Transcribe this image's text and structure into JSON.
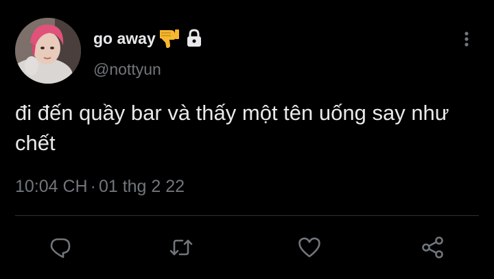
{
  "tweet": {
    "display_name": "go away",
    "handle": "@nottyun",
    "text": "đi đến quầy bar và thấy một tên uống say như chết",
    "time": "10:04 CH",
    "separator": "·",
    "date": "01 thg 2 22"
  },
  "icons": {
    "name_emoji": "thumbs-down-emoji",
    "protected": "lock-icon",
    "more": "vertical-ellipsis-icon",
    "actions": [
      "reply-icon",
      "retweet-icon",
      "like-icon",
      "share-icon"
    ]
  },
  "colors": {
    "background": "#000000",
    "text_primary": "#e7e9ea",
    "text_secondary": "#71767b",
    "divider": "#2f3336",
    "icon": "#71767b",
    "emoji": "#f7b731"
  }
}
